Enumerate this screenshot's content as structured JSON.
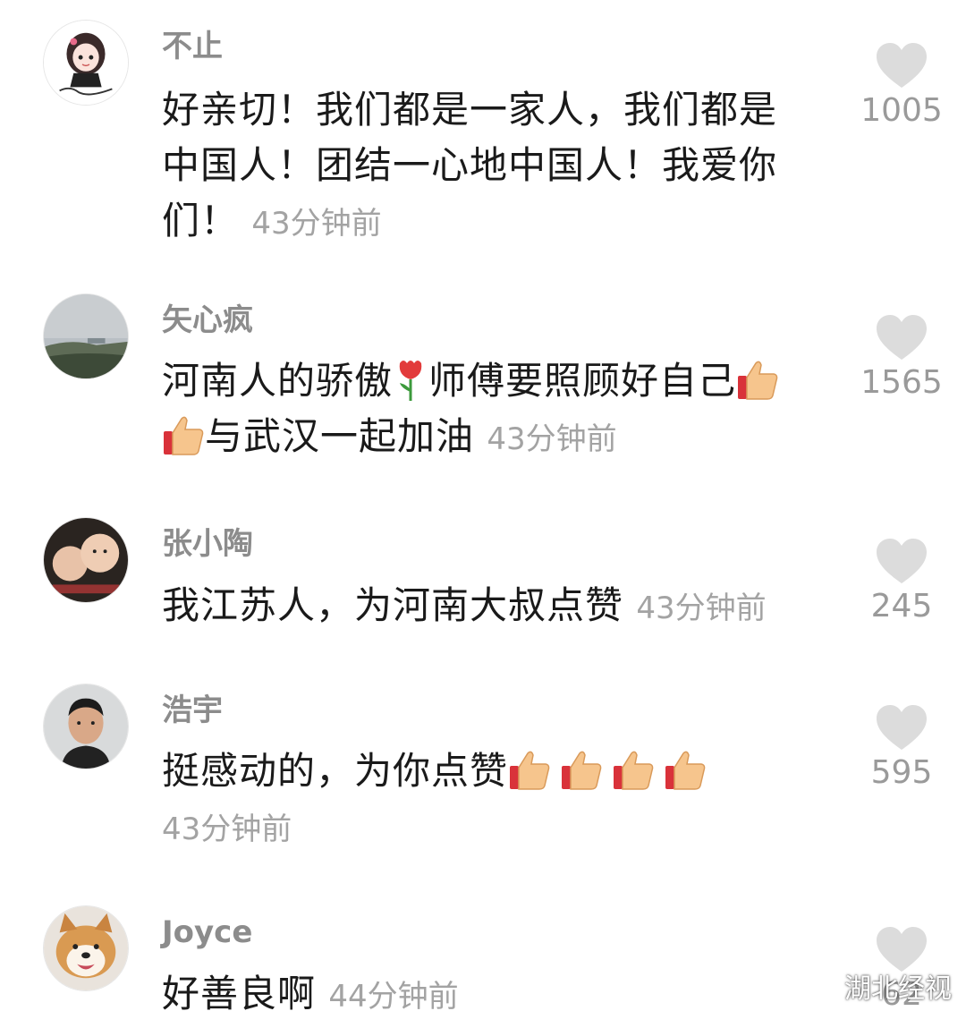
{
  "comments": [
    {
      "username": "不止",
      "lines": [
        "好亲切！我们都是一家人，我们都是",
        "中国人！团结一心地中国人！我爱你",
        "们！"
      ],
      "time": "43分钟前",
      "likes": "1005",
      "avatar_icon": "cartoon-girl-avatar"
    },
    {
      "username": "矢心疯",
      "text_a": "河南人的骄傲",
      "text_b": "师傅要照顾好自己",
      "text_c": "与武汉一起加油",
      "time": "43分钟前",
      "likes": "1565",
      "emoji": [
        "tulip-icon",
        "thumbs-up-icon"
      ],
      "avatar_icon": "landscape-photo-avatar"
    },
    {
      "username": "张小陶",
      "text": "我江苏人，为河南大叔点赞",
      "time": "43分钟前",
      "likes": "245",
      "avatar_icon": "children-photo-avatar"
    },
    {
      "username": "浩宇",
      "text": "挺感动的，为你点赞",
      "time": "43分钟前",
      "likes": "595",
      "emoji_count": 4,
      "avatar_icon": "man-photo-avatar"
    },
    {
      "username": "Joyce",
      "text": "好善良啊",
      "time": "44分钟前",
      "likes": "62",
      "avatar_icon": "shiba-dog-avatar"
    }
  ],
  "watermark": {
    "text": "湖北经视",
    "icon": "wechat-icon"
  },
  "colors": {
    "heart": "#dcdcdc",
    "username": "#8c8c8c",
    "time": "#a3a3a3",
    "text": "#1a1a1a"
  }
}
